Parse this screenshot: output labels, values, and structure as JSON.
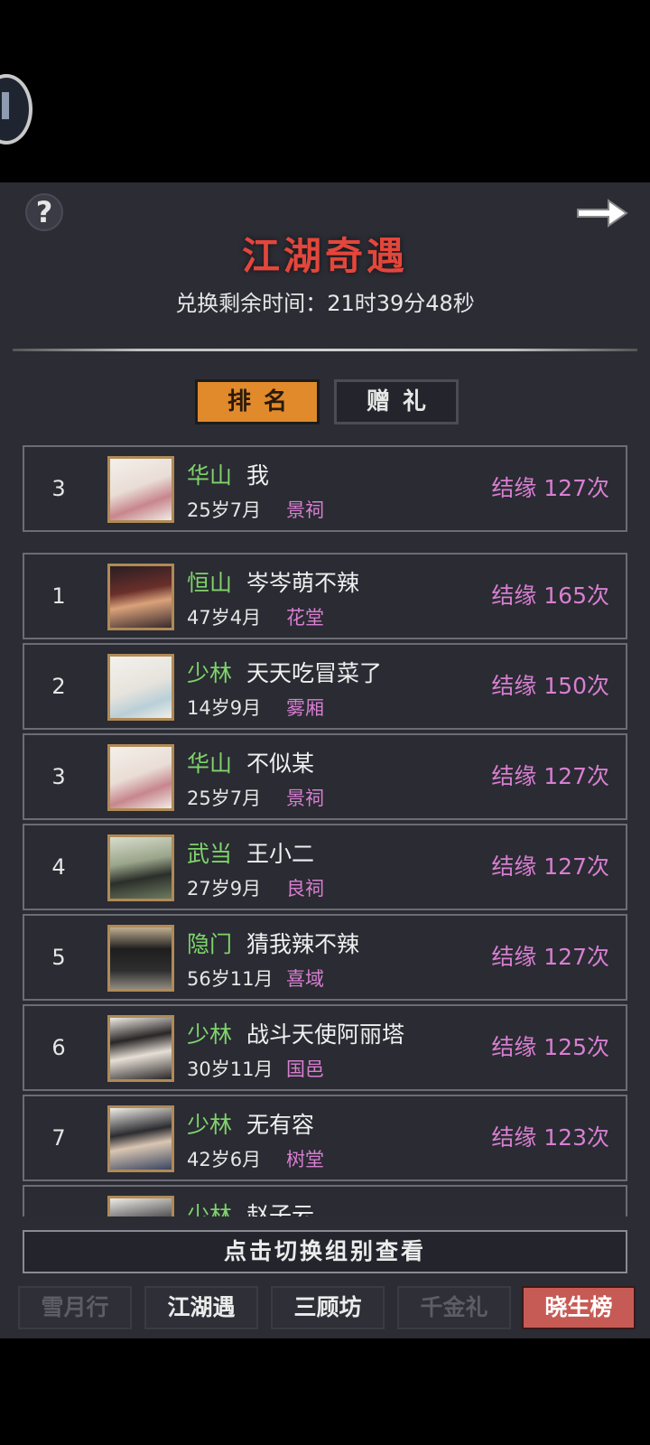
{
  "header": {
    "help_icon_glyph": "?",
    "title": "江湖奇遇",
    "timer_label": "兑换剩余时间：",
    "timer_value": "21时39分48秒"
  },
  "tabs": [
    {
      "label": "排名",
      "active": true
    },
    {
      "label": "赠礼",
      "active": false
    }
  ],
  "my_entry": {
    "rank": "3",
    "sect": "华山",
    "name": "我",
    "age": "25岁7月",
    "place": "景祠",
    "score": "结缘 127次"
  },
  "rankings": [
    {
      "rank": "1",
      "sect": "恒山",
      "name": "岑岑萌不辣",
      "age": "47岁4月",
      "place": "花堂",
      "score": "结缘 165次"
    },
    {
      "rank": "2",
      "sect": "少林",
      "name": "天天吃冒菜了",
      "age": "14岁9月",
      "place": "雾厢",
      "score": "结缘 150次"
    },
    {
      "rank": "3",
      "sect": "华山",
      "name": "不似某",
      "age": "25岁7月",
      "place": "景祠",
      "score": "结缘 127次"
    },
    {
      "rank": "4",
      "sect": "武当",
      "name": "王小二",
      "age": "27岁9月",
      "place": "良祠",
      "score": "结缘 127次"
    },
    {
      "rank": "5",
      "sect": "隐门",
      "name": "猜我辣不辣",
      "age": "56岁11月",
      "place": "喜域",
      "score": "结缘 127次"
    },
    {
      "rank": "6",
      "sect": "少林",
      "name": "战斗天使阿丽塔",
      "age": "30岁11月",
      "place": "国邑",
      "score": "结缘 125次"
    },
    {
      "rank": "7",
      "sect": "少林",
      "name": "无有容",
      "age": "42岁6月",
      "place": "树堂",
      "score": "结缘 123次"
    },
    {
      "rank": "",
      "sect": "少林",
      "name": "赵子云",
      "age": "",
      "place": "",
      "score": ""
    }
  ],
  "switch_label": "点击切换组别查看",
  "bottom_tabs": [
    {
      "label": "雪月行",
      "state": "disabled"
    },
    {
      "label": "江湖遇",
      "state": "normal"
    },
    {
      "label": "三顾坊",
      "state": "normal"
    },
    {
      "label": "千金礼",
      "state": "disabled"
    },
    {
      "label": "晓生榜",
      "state": "highlighted"
    }
  ],
  "colors": {
    "title": "#e4463b",
    "sect": "#7fd36b",
    "place": "#d77fd0",
    "active_tab": "#e08a2c",
    "highlight_tab": "#c65b55"
  },
  "icons": {
    "help": "question-icon",
    "next": "arrow-right-icon",
    "avatar": "player-avatar-icon"
  }
}
